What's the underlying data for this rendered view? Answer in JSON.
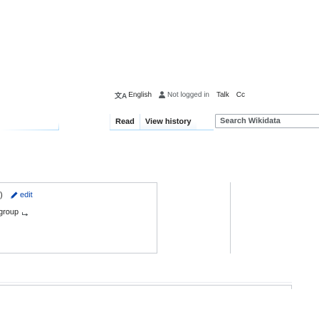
{
  "personal_tools": {
    "language_label": "English",
    "not_logged_in": "Not logged in",
    "talk": "Talk",
    "contributions": "Cc"
  },
  "views": {
    "tabs": [
      {
        "label": "Read",
        "selected": true
      },
      {
        "label": "View history",
        "selected": false
      }
    ]
  },
  "search": {
    "placeholder": "Search Wikidata",
    "value": ""
  },
  "statement": {
    "paren": ")",
    "edit_label": "edit",
    "group_text": "group"
  },
  "colors": {
    "link": "#0645ad",
    "border": "#c8ccd1",
    "tab_border": "#a7d7f9"
  }
}
